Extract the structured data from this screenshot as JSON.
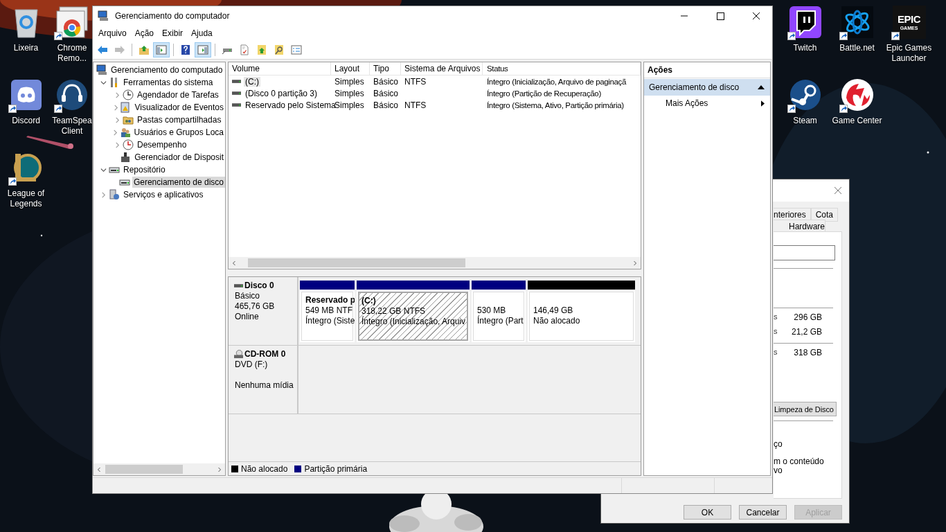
{
  "desktop": {
    "left_icons": [
      {
        "kind": "recycle-bin",
        "label_lines": [
          "Lixeira"
        ],
        "shortcut": false
      },
      {
        "kind": "chrome-remote",
        "label_lines": [
          "Chrome",
          "Remo..."
        ],
        "shortcut": true
      },
      {
        "kind": "discord",
        "label_lines": [
          "Discord"
        ],
        "shortcut": true
      },
      {
        "kind": "teamspeak",
        "label_lines": [
          "TeamSpea",
          "Client"
        ],
        "shortcut": true
      },
      {
        "kind": "league",
        "label_lines": [
          "League of",
          "Legends"
        ],
        "shortcut": true
      }
    ],
    "right_icons": [
      {
        "kind": "twitch",
        "label_lines": [
          "Twitch"
        ],
        "shortcut": true
      },
      {
        "kind": "battlenet",
        "label_lines": [
          "Battle.net"
        ],
        "shortcut": true
      },
      {
        "kind": "epic",
        "label_lines": [
          "Epic Games",
          "Launcher"
        ],
        "logo_lines": [
          "EPIC",
          "GAMES"
        ],
        "shortcut": true
      },
      {
        "kind": "steam",
        "label_lines": [
          "Steam"
        ],
        "shortcut": true
      },
      {
        "kind": "game-center",
        "label_lines": [
          "Game Center"
        ],
        "shortcut": true
      }
    ]
  },
  "background_dialog": {
    "tabs_row1": [
      "nteriores",
      "Cota"
    ],
    "tabs_row2": [
      "Hardware"
    ],
    "sizes": [
      {
        "label": "s",
        "value": "296 GB"
      },
      {
        "label": "s",
        "value": "21,2 GB"
      },
      {
        "label": "s",
        "value": "318 GB"
      }
    ],
    "cleanup_button": "Limpeza de Disco",
    "fragments": [
      "ço",
      "m o conteúdo",
      "vo"
    ],
    "buttons": [
      {
        "label": "OK",
        "disabled": false
      },
      {
        "label": "Cancelar",
        "disabled": false
      },
      {
        "label": "Aplicar",
        "disabled": true
      }
    ]
  },
  "window": {
    "title": "Gerenciamento do computador",
    "menu": [
      "Arquivo",
      "Ação",
      "Exibir",
      "Ajuda"
    ],
    "toolbar": [
      {
        "kind": "back",
        "pressed": false,
        "disabled": false
      },
      {
        "kind": "forward",
        "pressed": false,
        "disabled": true
      },
      {
        "kind": "separator"
      },
      {
        "kind": "up-folder",
        "pressed": false,
        "disabled": false
      },
      {
        "kind": "tree-toggle",
        "pressed": true,
        "disabled": false
      },
      {
        "kind": "separator"
      },
      {
        "kind": "help",
        "pressed": false,
        "disabled": false
      },
      {
        "kind": "pane-toggle",
        "pressed": true,
        "disabled": false
      },
      {
        "kind": "separator"
      },
      {
        "kind": "connect",
        "pressed": false,
        "disabled": false
      },
      {
        "kind": "check",
        "pressed": false,
        "disabled": false
      },
      {
        "kind": "folder-up",
        "pressed": false,
        "disabled": false
      },
      {
        "kind": "folder-search",
        "pressed": false,
        "disabled": false
      },
      {
        "kind": "properties",
        "pressed": false,
        "disabled": false
      }
    ],
    "tree": [
      {
        "kind": "computer",
        "label": "Gerenciamento do computado",
        "selected": false,
        "children": [
          {
            "kind": "tools",
            "label": "Ferramentas do sistema",
            "expanded": true,
            "selected": false,
            "children": [
              {
                "kind": "scheduler",
                "label": "Agendador de Tarefas",
                "expanded": false,
                "selected": false
              },
              {
                "kind": "events",
                "label": "Visualizador de Eventos",
                "expanded": false,
                "selected": false
              },
              {
                "kind": "shares",
                "label": "Pastas compartilhadas",
                "expanded": false,
                "selected": false
              },
              {
                "kind": "users",
                "label": "Usuários e Grupos Loca",
                "expanded": false,
                "selected": false
              },
              {
                "kind": "performance",
                "label": "Desempenho",
                "expanded": false,
                "selected": false
              },
              {
                "kind": "devices",
                "label": "Gerenciador de Disposit",
                "selected": false
              }
            ]
          },
          {
            "kind": "storage",
            "label": "Repositório",
            "expanded": true,
            "selected": false,
            "children": [
              {
                "kind": "disk",
                "label": "Gerenciamento de disco",
                "selected": true
              }
            ]
          },
          {
            "kind": "services",
            "label": "Serviços e aplicativos",
            "expanded": false,
            "selected": false
          }
        ]
      }
    ],
    "volumes": {
      "columns": [
        "Volume",
        "Layout",
        "Tipo",
        "Sistema de Arquivos",
        "Status"
      ],
      "rows": [
        {
          "selected": true,
          "cells": [
            "(C:)",
            "Simples",
            "Básico",
            "NTFS",
            "Íntegro (Inicialização, Arquivo de paginaçã"
          ]
        },
        {
          "selected": false,
          "cells": [
            "(Disco 0 partição 3)",
            "Simples",
            "Básico",
            "",
            "Íntegro (Partição de Recuperação)"
          ]
        },
        {
          "selected": false,
          "cells": [
            "Reservado pelo Sistema",
            "Simples",
            "Básico",
            "NTFS",
            "Íntegro (Sistema, Ativo, Partição primária)"
          ]
        }
      ]
    },
    "disks": [
      {
        "kind": "disk",
        "name": "Disco 0",
        "lines": [
          "Básico",
          "465,76 GB",
          "Online"
        ],
        "partitions": [
          {
            "name": "Reservado p",
            "lines": [
              "549 MB NTF",
              "Íntegro (Siste"
            ],
            "color": "#000080",
            "selected": false
          },
          {
            "name": "(C:)",
            "lines": [
              "318,22 GB NTFS",
              "Íntegro (Inicialização, Arquiv"
            ],
            "color": "#000080",
            "selected": true
          },
          {
            "lines": [
              "530 MB",
              "Íntegro (Part"
            ],
            "color": "#000080",
            "selected": false
          },
          {
            "lines": [
              "146,49 GB",
              "Não alocado"
            ],
            "color": "#000000",
            "selected": false
          }
        ]
      },
      {
        "kind": "cdrom",
        "name": "CD-ROM 0",
        "lines": [
          "DVD (F:)",
          "Nenhuma mídia"
        ]
      }
    ],
    "legend": [
      {
        "label": "Não alocado",
        "color": "#000000"
      },
      {
        "label": "Partição primária",
        "color": "#000080"
      }
    ],
    "actions": {
      "header": "Ações",
      "sections": [
        {
          "title": "Gerenciamento de disco",
          "expanded": true,
          "items": [
            {
              "label": "Mais Ações",
              "submenu": true
            }
          ]
        }
      ]
    }
  }
}
